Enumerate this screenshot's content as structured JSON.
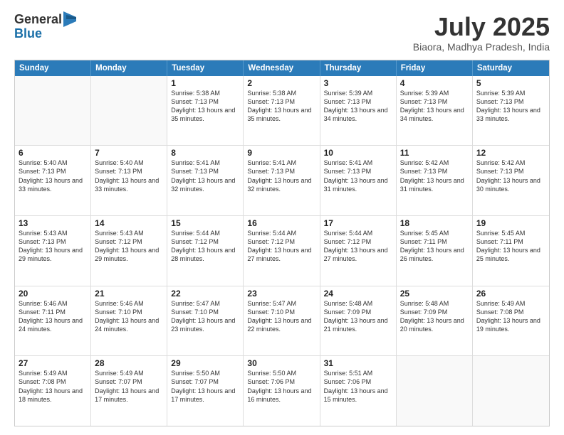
{
  "logo": {
    "general": "General",
    "blue": "Blue"
  },
  "title": "July 2025",
  "location": "Biaora, Madhya Pradesh, India",
  "header_days": [
    "Sunday",
    "Monday",
    "Tuesday",
    "Wednesday",
    "Thursday",
    "Friday",
    "Saturday"
  ],
  "weeks": [
    [
      {
        "day": "",
        "info": ""
      },
      {
        "day": "",
        "info": ""
      },
      {
        "day": "1",
        "info": "Sunrise: 5:38 AM\nSunset: 7:13 PM\nDaylight: 13 hours and 35 minutes."
      },
      {
        "day": "2",
        "info": "Sunrise: 5:38 AM\nSunset: 7:13 PM\nDaylight: 13 hours and 35 minutes."
      },
      {
        "day": "3",
        "info": "Sunrise: 5:39 AM\nSunset: 7:13 PM\nDaylight: 13 hours and 34 minutes."
      },
      {
        "day": "4",
        "info": "Sunrise: 5:39 AM\nSunset: 7:13 PM\nDaylight: 13 hours and 34 minutes."
      },
      {
        "day": "5",
        "info": "Sunrise: 5:39 AM\nSunset: 7:13 PM\nDaylight: 13 hours and 33 minutes."
      }
    ],
    [
      {
        "day": "6",
        "info": "Sunrise: 5:40 AM\nSunset: 7:13 PM\nDaylight: 13 hours and 33 minutes."
      },
      {
        "day": "7",
        "info": "Sunrise: 5:40 AM\nSunset: 7:13 PM\nDaylight: 13 hours and 33 minutes."
      },
      {
        "day": "8",
        "info": "Sunrise: 5:41 AM\nSunset: 7:13 PM\nDaylight: 13 hours and 32 minutes."
      },
      {
        "day": "9",
        "info": "Sunrise: 5:41 AM\nSunset: 7:13 PM\nDaylight: 13 hours and 32 minutes."
      },
      {
        "day": "10",
        "info": "Sunrise: 5:41 AM\nSunset: 7:13 PM\nDaylight: 13 hours and 31 minutes."
      },
      {
        "day": "11",
        "info": "Sunrise: 5:42 AM\nSunset: 7:13 PM\nDaylight: 13 hours and 31 minutes."
      },
      {
        "day": "12",
        "info": "Sunrise: 5:42 AM\nSunset: 7:13 PM\nDaylight: 13 hours and 30 minutes."
      }
    ],
    [
      {
        "day": "13",
        "info": "Sunrise: 5:43 AM\nSunset: 7:13 PM\nDaylight: 13 hours and 29 minutes."
      },
      {
        "day": "14",
        "info": "Sunrise: 5:43 AM\nSunset: 7:12 PM\nDaylight: 13 hours and 29 minutes."
      },
      {
        "day": "15",
        "info": "Sunrise: 5:44 AM\nSunset: 7:12 PM\nDaylight: 13 hours and 28 minutes."
      },
      {
        "day": "16",
        "info": "Sunrise: 5:44 AM\nSunset: 7:12 PM\nDaylight: 13 hours and 27 minutes."
      },
      {
        "day": "17",
        "info": "Sunrise: 5:44 AM\nSunset: 7:12 PM\nDaylight: 13 hours and 27 minutes."
      },
      {
        "day": "18",
        "info": "Sunrise: 5:45 AM\nSunset: 7:11 PM\nDaylight: 13 hours and 26 minutes."
      },
      {
        "day": "19",
        "info": "Sunrise: 5:45 AM\nSunset: 7:11 PM\nDaylight: 13 hours and 25 minutes."
      }
    ],
    [
      {
        "day": "20",
        "info": "Sunrise: 5:46 AM\nSunset: 7:11 PM\nDaylight: 13 hours and 24 minutes."
      },
      {
        "day": "21",
        "info": "Sunrise: 5:46 AM\nSunset: 7:10 PM\nDaylight: 13 hours and 24 minutes."
      },
      {
        "day": "22",
        "info": "Sunrise: 5:47 AM\nSunset: 7:10 PM\nDaylight: 13 hours and 23 minutes."
      },
      {
        "day": "23",
        "info": "Sunrise: 5:47 AM\nSunset: 7:10 PM\nDaylight: 13 hours and 22 minutes."
      },
      {
        "day": "24",
        "info": "Sunrise: 5:48 AM\nSunset: 7:09 PM\nDaylight: 13 hours and 21 minutes."
      },
      {
        "day": "25",
        "info": "Sunrise: 5:48 AM\nSunset: 7:09 PM\nDaylight: 13 hours and 20 minutes."
      },
      {
        "day": "26",
        "info": "Sunrise: 5:49 AM\nSunset: 7:08 PM\nDaylight: 13 hours and 19 minutes."
      }
    ],
    [
      {
        "day": "27",
        "info": "Sunrise: 5:49 AM\nSunset: 7:08 PM\nDaylight: 13 hours and 18 minutes."
      },
      {
        "day": "28",
        "info": "Sunrise: 5:49 AM\nSunset: 7:07 PM\nDaylight: 13 hours and 17 minutes."
      },
      {
        "day": "29",
        "info": "Sunrise: 5:50 AM\nSunset: 7:07 PM\nDaylight: 13 hours and 17 minutes."
      },
      {
        "day": "30",
        "info": "Sunrise: 5:50 AM\nSunset: 7:06 PM\nDaylight: 13 hours and 16 minutes."
      },
      {
        "day": "31",
        "info": "Sunrise: 5:51 AM\nSunset: 7:06 PM\nDaylight: 13 hours and 15 minutes."
      },
      {
        "day": "",
        "info": ""
      },
      {
        "day": "",
        "info": ""
      }
    ]
  ]
}
